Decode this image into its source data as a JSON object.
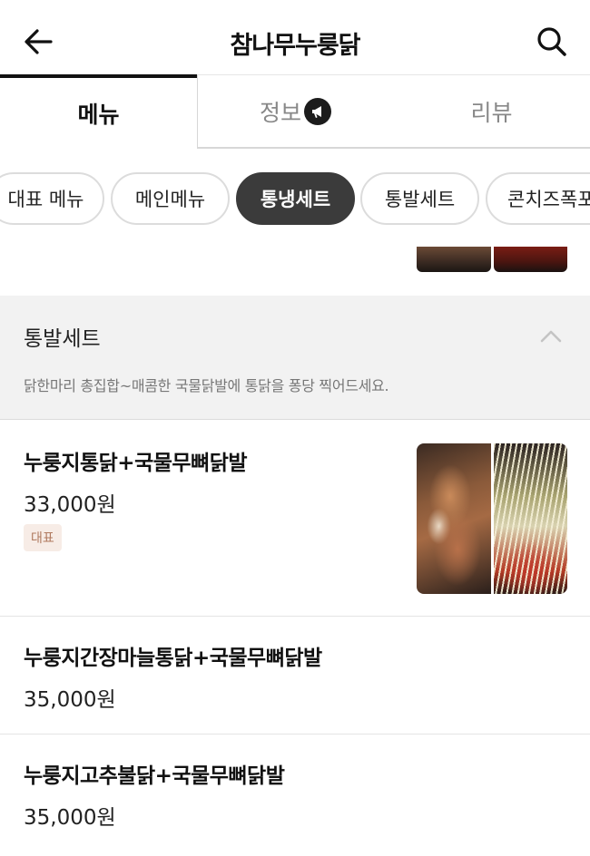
{
  "header": {
    "title": "참나무누룽닭",
    "back_icon": "arrow-left-icon",
    "search_icon": "search-icon"
  },
  "tabs": [
    {
      "label": "메뉴",
      "active": true
    },
    {
      "label": "정보",
      "active": false,
      "icon": "megaphone-icon"
    },
    {
      "label": "리뷰",
      "active": false
    }
  ],
  "categories": [
    {
      "label": "대표 메뉴",
      "active": false
    },
    {
      "label": "메인메뉴",
      "active": false
    },
    {
      "label": "통냉세트",
      "active": true
    },
    {
      "label": "통발세트",
      "active": false
    },
    {
      "label": "콘치즈폭포",
      "active": false
    }
  ],
  "section": {
    "title": "통발세트",
    "description": "닭한마리 총집합~매콤한 국물닭발에 통닭을 퐁당 찍어드세요.",
    "collapse_icon": "chevron-up-icon"
  },
  "items": [
    {
      "name": "누룽지통닭+국물무뼈닭발",
      "price": "33,000원",
      "badge": "대표",
      "image": "roast-chicken-and-spicy-feet-photo"
    },
    {
      "name": "누룽지간장마늘통닭+국물무뼈닭발",
      "price": "35,000원"
    },
    {
      "name": "누룽지고추불닭+국물무뼈닭발",
      "price": "35,000원"
    }
  ],
  "colors": {
    "active_chip_bg": "#3b3b3b",
    "section_bg": "#f2f2f2",
    "badge_bg": "#f7ece6",
    "badge_text": "#b07a5f"
  }
}
